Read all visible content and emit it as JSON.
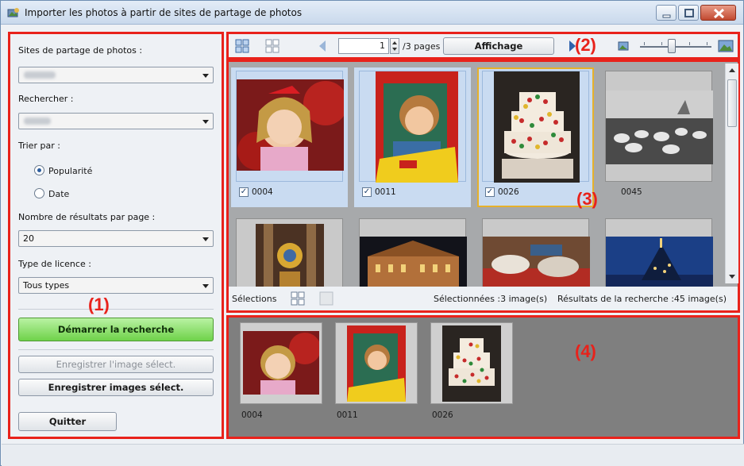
{
  "window": {
    "title": "Importer les photos à partir de sites de partage de photos"
  },
  "left": {
    "sites_label": "Sites de partage de photos :",
    "search_label": "Rechercher :",
    "sort_label": "Trier par :",
    "sort_options": [
      "Popularité",
      "Date"
    ],
    "sort_selected": "Popularité",
    "results_label": "Nombre de résultats par page :",
    "results_value": "20",
    "license_label": "Type de licence :",
    "license_value": "Tous types",
    "start_search": "Démarrer la recherche",
    "save_selected_image": "Enregistrer l'image sélect.",
    "save_selected_images": "Enregistrer images sélect.",
    "quit": "Quitter"
  },
  "toolbar": {
    "page_value": "1",
    "pages_label": "/3 pages",
    "view_button": "Affichage"
  },
  "thumbs": {
    "items": [
      {
        "label": "0004",
        "checked": true
      },
      {
        "label": "0011",
        "checked": true
      },
      {
        "label": "0026",
        "checked": true
      },
      {
        "label": "0045",
        "checked": false
      }
    ],
    "selections_label": "Sélections",
    "selected_count": "Sélectionnées :3 image(s)",
    "results_count": "Résultats de la recherche :45 image(s)"
  },
  "tray": {
    "items": [
      "0004",
      "0011",
      "0026"
    ]
  },
  "callouts": {
    "c1": "(1)",
    "c2": "(2)",
    "c3": "(3)",
    "c4": "(4)"
  },
  "colors": {
    "callout_red": "#e8221b",
    "search_green": "#6fd24a",
    "selection_blue": "#c9dbf1",
    "focus_gold": "#e6b12b"
  },
  "icons": [
    "app-icon",
    "minimize-icon",
    "maximize-icon",
    "close-icon",
    "grid-select-all-icon",
    "grid-deselect-icon",
    "prev-page-icon",
    "next-page-icon",
    "small-thumb-icon",
    "large-thumb-icon"
  ]
}
